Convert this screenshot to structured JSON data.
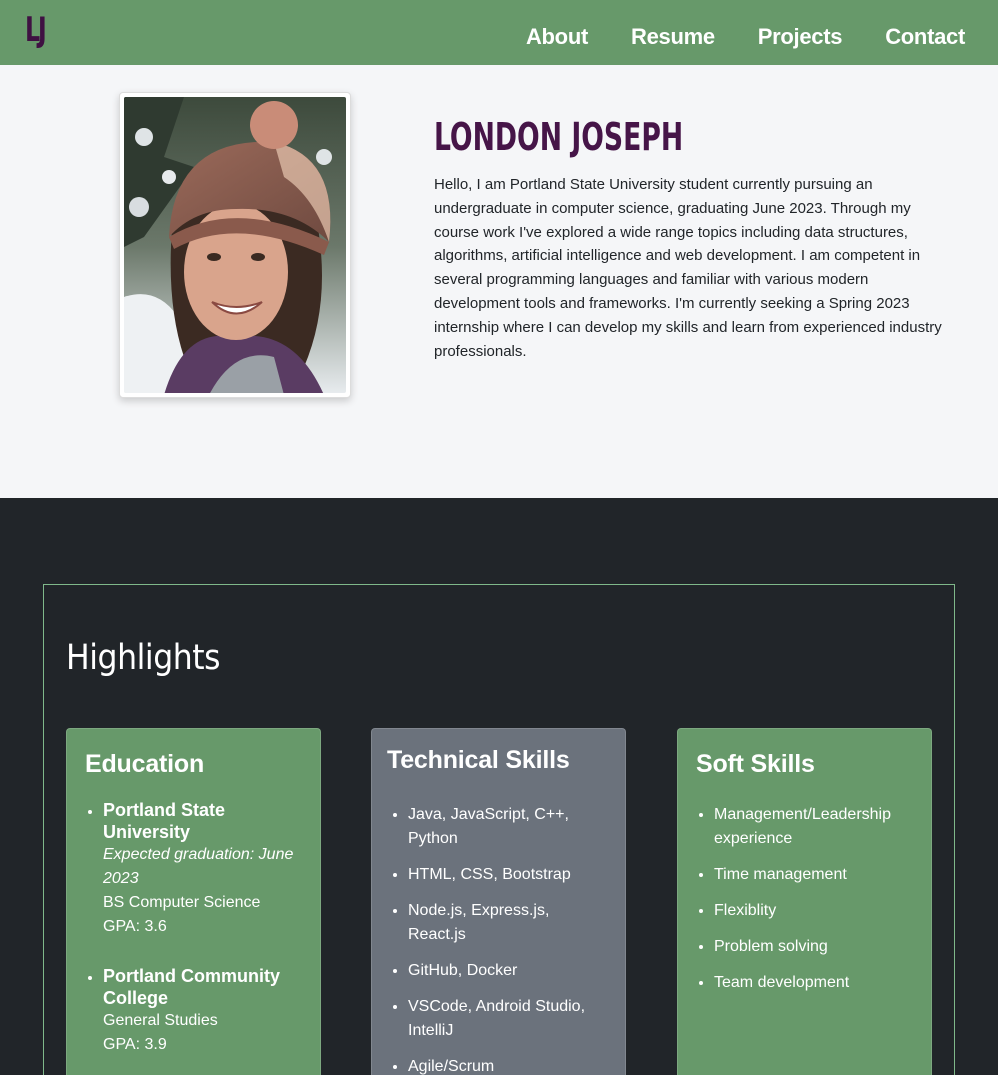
{
  "nav": {
    "brand": "LJ",
    "links": [
      "About",
      "Resume",
      "Projects",
      "Contact"
    ]
  },
  "about": {
    "name": "LONDON JOSEPH",
    "bio": "Hello, I am Portland State University student currently pursuing an undergraduate in computer science, graduating June 2023. Through my course work I've explored a wide range topics including data structures, algorithms, artificial intelligence and web development. I am competent in several programming languages and familiar with various modern development tools and frameworks. I'm currently seeking a Spring 2023 internship where I can develop my skills and learn from experienced industry professionals."
  },
  "highlights": {
    "title": "Highlights",
    "education": {
      "title": "Education",
      "items": [
        {
          "school": "Portland State University",
          "italic": "Expected graduation: June 2023",
          "lines": [
            "BS Computer Science",
            "GPA: 3.6"
          ]
        },
        {
          "school": "Portland Community College",
          "lines": [
            "General Studies",
            "GPA: 3.9"
          ]
        }
      ]
    },
    "technical": {
      "title": "Technical Skills",
      "items": [
        "Java, JavaScript, C++, Python",
        "HTML, CSS, Bootstrap",
        "Node.js, Express.js, React.js",
        "GitHub, Docker",
        "VSCode, Android Studio, IntelliJ",
        "Agile/Scrum"
      ]
    },
    "soft": {
      "title": "Soft Skills",
      "items": [
        "Management/Leadership experience",
        "Time management",
        "Flexiblity",
        "Problem solving",
        "Team development"
      ]
    }
  },
  "colors": {
    "nav_green": "#67996a",
    "brand_purple": "#461548",
    "dark_bg": "#212529",
    "card_gray": "#6b727c"
  }
}
